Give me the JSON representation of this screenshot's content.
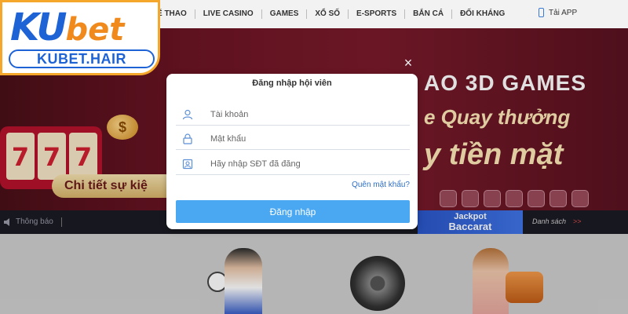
{
  "nav": {
    "items": [
      "Ể THAO",
      "LIVE CASINO",
      "GAMES",
      "XỔ SỐ",
      "E-SPORTS",
      "BẮN CÁ",
      "ĐỐI KHÁNG"
    ],
    "app_label": "Tải APP"
  },
  "logo": {
    "mark_k": "K",
    "mark_u": "U",
    "mark_bet": "bet",
    "domain": "KUBET.HAIR"
  },
  "banner": {
    "title": "AO  3D GAMES",
    "sub1": "e Quay thưởng",
    "sub2": "y tiền mặt",
    "detail_button": "Chi tiết sự kiệ",
    "coin_symbol": "$"
  },
  "notice": {
    "label": "Thông báo",
    "jackpot_top": "Jackpot",
    "jackpot_bottom": "Baccarat",
    "list_label": "Danh sách",
    "list_arrow": ">>"
  },
  "modal": {
    "title": "Đăng nhập hội viên",
    "username_placeholder": "Tài khoản",
    "password_placeholder": "Mật khẩu",
    "phone_placeholder": "Hãy nhập SĐT đã đăng",
    "forgot_label": "Quên mật khẩu?",
    "login_label": "Đăng nhập",
    "close_label": "×"
  },
  "colors": {
    "accent": "#4aa8f2",
    "brand_blue": "#1e63d6",
    "brand_orange": "#f08a1c",
    "link": "#2f6fc4"
  },
  "icons": {
    "user_field": "user-icon",
    "password_field": "lock-icon",
    "phone_field": "id-card-icon",
    "app": "phone-icon",
    "notice": "speaker-icon"
  }
}
